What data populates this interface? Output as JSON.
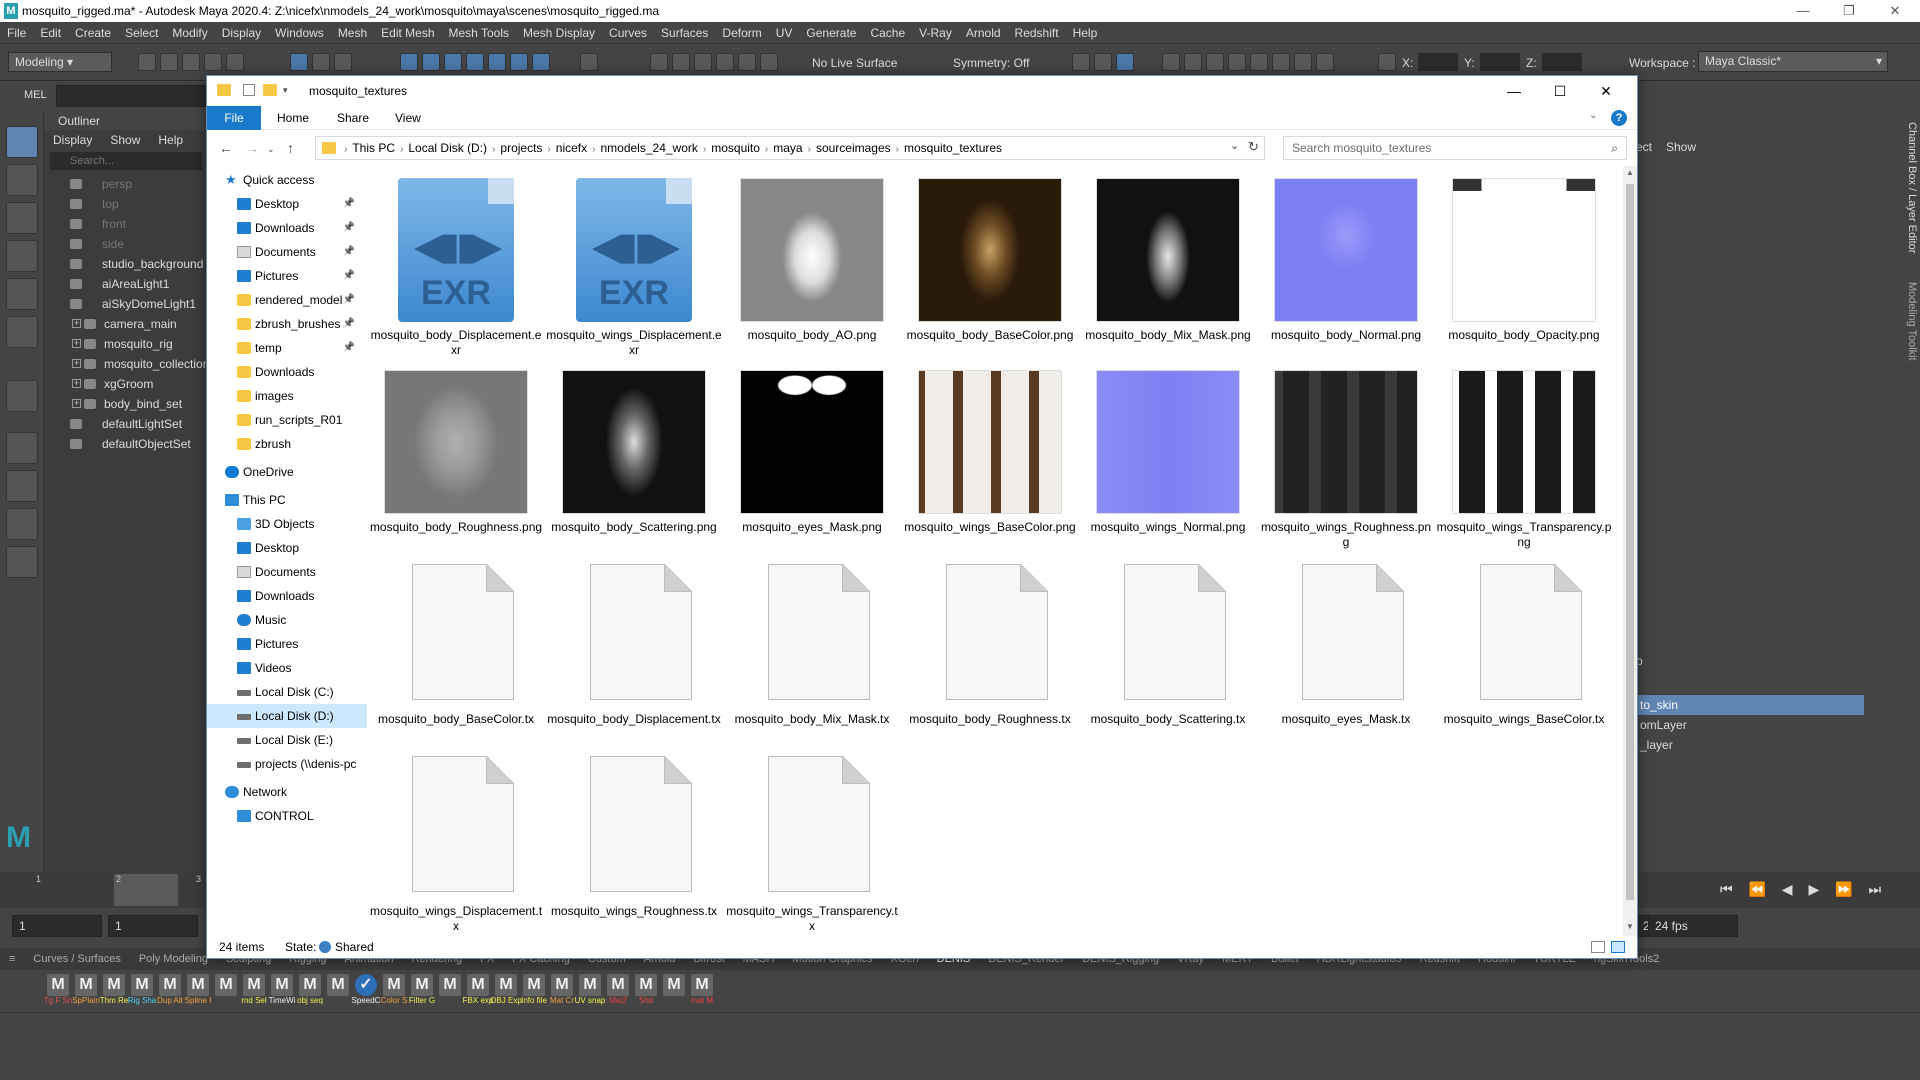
{
  "maya": {
    "title": "mosquito_rigged.ma* - Autodesk Maya 2020.4: Z:\\nicefx\\nmodels_24_work\\mosquito\\maya\\scenes\\mosquito_rigged.ma",
    "menus": [
      "File",
      "Edit",
      "Create",
      "Select",
      "Modify",
      "Display",
      "Windows",
      "Mesh",
      "Edit Mesh",
      "Mesh Tools",
      "Mesh Display",
      "Curves",
      "Surfaces",
      "Deform",
      "UV",
      "Generate",
      "Cache",
      "V-Ray",
      "Arnold",
      "Redshift",
      "Help"
    ],
    "mode": "Modeling",
    "live_surface": "No Live Surface",
    "symmetry": "Symmetry: Off",
    "workspace_label": "Workspace :",
    "workspace": "Maya Classic*",
    "coord_x": "X:",
    "coord_y": "Y:",
    "coord_z": "Z:",
    "mel_label": "MEL",
    "outliner": {
      "title": "Outliner",
      "menus": [
        "Display",
        "Show",
        "Help"
      ],
      "search_placeholder": "Search...",
      "items": [
        {
          "label": "persp",
          "dim": true
        },
        {
          "label": "top",
          "dim": true
        },
        {
          "label": "front",
          "dim": true
        },
        {
          "label": "side",
          "dim": true
        },
        {
          "label": "studio_background",
          "dim": false
        },
        {
          "label": "aiAreaLight1",
          "dim": false
        },
        {
          "label": "aiSkyDomeLight1",
          "dim": false
        },
        {
          "label": "camera_main",
          "dim": false
        },
        {
          "label": "mosquito_rig",
          "dim": false
        },
        {
          "label": "mosquito_collection",
          "dim": false
        },
        {
          "label": "xgGroom",
          "dim": false
        },
        {
          "label": "body_bind_set",
          "dim": false
        },
        {
          "label": "defaultLightSet",
          "dim": false
        },
        {
          "label": "defaultObjectSet",
          "dim": false
        }
      ]
    },
    "channel_box_label": "Channel Box / Layer Editor",
    "modeling_toolkit_label": "Modeling Toolkit",
    "channel_menu_show": "Show",
    "channel_menu_partial": "ect",
    "layers": [
      {
        "label": "to_skin",
        "selected": true
      },
      {
        "label": "omLayer",
        "selected": false
      },
      {
        "label": "_layer",
        "selected": false
      }
    ],
    "layer_header_partial": "p",
    "time_ticks": [
      "1",
      "2",
      "3"
    ],
    "range_start": "1",
    "range_start2": "1",
    "range_end_partial": "2",
    "fps": "24 fps",
    "shelf_tabs": [
      "Curves / Surfaces",
      "Poly Modeling",
      "Sculpting",
      "Rigging",
      "Animation",
      "Rendering",
      "FX",
      "FX Caching",
      "Custom",
      "Arnold",
      "Bifrost",
      "MASH",
      "Motion Graphics",
      "XGen",
      "DENIS",
      "DENIS_Render",
      "DENIS_Rigging",
      "VRay",
      "MERT",
      "Bullet",
      "HDRLightStudio5",
      "Redshift",
      "Houdini",
      "TURTLE",
      "ngSkinTools2"
    ],
    "active_shelf": "DENIS",
    "shelf_icons": [
      "Tg F Sn",
      "SpPlain",
      "Thm Re",
      "Rig Sha",
      "Dup Alt",
      "Spline I",
      "",
      "rnd Sel",
      "TimeWi",
      "obj seq",
      "",
      "SpeedC",
      "Color S",
      "Filter G",
      "",
      "FBX exp",
      "OBJ Exp",
      "Info file",
      "Mat Cr",
      "UV snap",
      "Mat2",
      "Shd",
      "",
      "mat M"
    ]
  },
  "explorer": {
    "title": "mosquito_textures",
    "tabs": {
      "file": "File",
      "home": "Home",
      "share": "Share",
      "view": "View"
    },
    "help": "?",
    "breadcrumbs": [
      "This PC",
      "Local Disk (D:)",
      "projects",
      "nicefx",
      "nmodels_24_work",
      "mosquito",
      "maya",
      "sourceimages",
      "mosquito_textures"
    ],
    "search_placeholder": "Search mosquito_textures",
    "nav": [
      {
        "label": "Quick access",
        "type": "star",
        "lvl": 0
      },
      {
        "label": "Desktop",
        "type": "blue",
        "pin": true
      },
      {
        "label": "Downloads",
        "type": "blue",
        "pin": true
      },
      {
        "label": "Documents",
        "type": "doc",
        "pin": true
      },
      {
        "label": "Pictures",
        "type": "blue",
        "pin": true
      },
      {
        "label": "rendered_model",
        "type": "folder",
        "pin": true
      },
      {
        "label": "zbrush_brushes",
        "type": "folder",
        "pin": true
      },
      {
        "label": "temp",
        "type": "folder",
        "pin": true
      },
      {
        "label": "Downloads",
        "type": "folder",
        "pin": false
      },
      {
        "label": "images",
        "type": "folder",
        "pin": false
      },
      {
        "label": "run_scripts_R01",
        "type": "folder",
        "pin": false
      },
      {
        "label": "zbrush",
        "type": "folder",
        "pin": false
      },
      {
        "label": "",
        "type": "gap"
      },
      {
        "label": "OneDrive",
        "type": "cloud",
        "lvl": 0
      },
      {
        "label": "",
        "type": "gap"
      },
      {
        "label": "This PC",
        "type": "pc",
        "lvl": 0
      },
      {
        "label": "3D Objects",
        "type": "cube"
      },
      {
        "label": "Desktop",
        "type": "blue"
      },
      {
        "label": "Documents",
        "type": "doc"
      },
      {
        "label": "Downloads",
        "type": "blue"
      },
      {
        "label": "Music",
        "type": "music"
      },
      {
        "label": "Pictures",
        "type": "blue"
      },
      {
        "label": "Videos",
        "type": "blue"
      },
      {
        "label": "Local Disk (C:)",
        "type": "drive"
      },
      {
        "label": "Local Disk (D:)",
        "type": "drive",
        "sel": true
      },
      {
        "label": "Local Disk (E:)",
        "type": "drive"
      },
      {
        "label": "projects (\\\\denis-pc",
        "type": "drive"
      },
      {
        "label": "",
        "type": "gap"
      },
      {
        "label": "Network",
        "type": "net",
        "lvl": 0
      },
      {
        "label": "CONTROL",
        "type": "pc"
      }
    ],
    "files": [
      {
        "name": "mosquito_body_Displacement.exr",
        "kind": "exr"
      },
      {
        "name": "mosquito_wings_Displacement.exr",
        "kind": "exr"
      },
      {
        "name": "mosquito_body_AO.png",
        "kind": "ao"
      },
      {
        "name": "mosquito_body_BaseColor.png",
        "kind": "basecolor"
      },
      {
        "name": "mosquito_body_Mix_Mask.png",
        "kind": "mixmask"
      },
      {
        "name": "mosquito_body_Normal.png",
        "kind": "normal"
      },
      {
        "name": "mosquito_body_Opacity.png",
        "kind": "opacity"
      },
      {
        "name": "mosquito_body_Roughness.png",
        "kind": "rough"
      },
      {
        "name": "mosquito_body_Scattering.png",
        "kind": "scatter"
      },
      {
        "name": "mosquito_eyes_Mask.png",
        "kind": "eyes"
      },
      {
        "name": "mosquito_wings_BaseColor.png",
        "kind": "wingcolor"
      },
      {
        "name": "mosquito_wings_Normal.png",
        "kind": "wingnormal"
      },
      {
        "name": "mosquito_wings_Roughness.png",
        "kind": "wingrough"
      },
      {
        "name": "mosquito_wings_Transparency.png",
        "kind": "wingtrans"
      },
      {
        "name": "mosquito_body_BaseColor.tx",
        "kind": "blank"
      },
      {
        "name": "mosquito_body_Displacement.tx",
        "kind": "blank"
      },
      {
        "name": "mosquito_body_Mix_Mask.tx",
        "kind": "blank"
      },
      {
        "name": "mosquito_body_Roughness.tx",
        "kind": "blank"
      },
      {
        "name": "mosquito_body_Scattering.tx",
        "kind": "blank"
      },
      {
        "name": "mosquito_eyes_Mask.tx",
        "kind": "blank"
      },
      {
        "name": "mosquito_wings_BaseColor.tx",
        "kind": "blank"
      },
      {
        "name": "mosquito_wings_Displacement.tx",
        "kind": "blank"
      },
      {
        "name": "mosquito_wings_Roughness.tx",
        "kind": "blank"
      },
      {
        "name": "mosquito_wings_Transparency.tx",
        "kind": "blank"
      }
    ],
    "status": {
      "count": "24 items",
      "state_label": "State:",
      "state_value": "Shared"
    }
  },
  "colors": {
    "accent": "#1979ca",
    "selection": "#cce8ff",
    "maya_bg": "#444444",
    "maya_select": "#5f86b3"
  }
}
